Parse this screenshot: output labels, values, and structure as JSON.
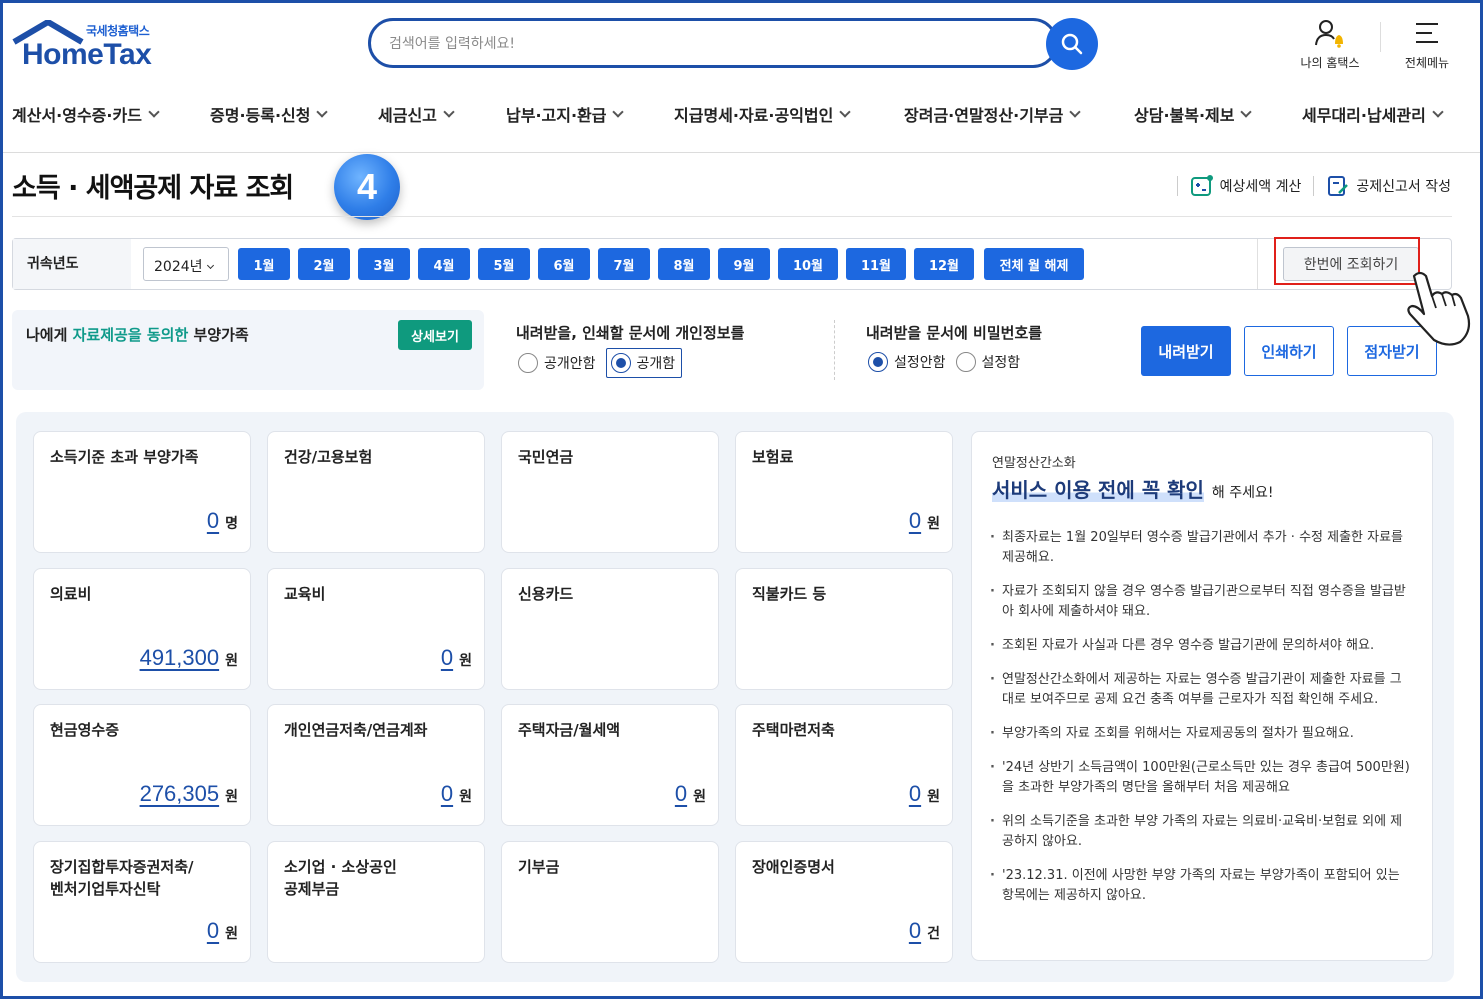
{
  "header": {
    "logo_small": "국세청홈택스",
    "logo_big": "HomeTax",
    "search_placeholder": "검색어를 입력하세요!",
    "my_hometax": "나의 홈택스",
    "all_menu": "전체메뉴"
  },
  "nav": {
    "items": [
      {
        "label": "계산서·영수증·카드"
      },
      {
        "label": "증명·등록·신청"
      },
      {
        "label": "세금신고"
      },
      {
        "label": "납부·고지·환급"
      },
      {
        "label": "지급명세·자료·공익법인"
      },
      {
        "label": "장려금·연말정산·기부금"
      },
      {
        "label": "상담·불복·제보"
      },
      {
        "label": "세무대리·납세관리"
      }
    ]
  },
  "page": {
    "title": "소득 · 세액공제 자료 조회",
    "step_number": "4",
    "action_estimate": "예상세액 계산",
    "action_write": "공제신고서 작성"
  },
  "filter": {
    "label": "귀속년도",
    "year": "2024년",
    "months": [
      "1월",
      "2월",
      "3월",
      "4월",
      "5월",
      "6월",
      "7월",
      "8월",
      "9월",
      "10월",
      "11월",
      "12월"
    ],
    "clear_all": "전체 월 해제",
    "query_all": "한번에 조회하기"
  },
  "consent": {
    "prefix": "나에게 ",
    "highlight": "자료제공을 동의한",
    "suffix": " 부양가족",
    "detail_btn": "상세보기"
  },
  "privacy": {
    "title": "내려받을, 인쇄할 문서에 개인정보를",
    "opt1": "공개안함",
    "opt2": "공개함",
    "selected": "공개함"
  },
  "password": {
    "title": "내려받을 문서에 비밀번호를",
    "opt1": "설정안함",
    "opt2": "설정함",
    "selected": "설정안함"
  },
  "actions": {
    "download": "내려받기",
    "print": "인쇄하기",
    "braille": "점자받기"
  },
  "cards": [
    {
      "title": "소득기준 초과 부양가족",
      "value": "0",
      "unit": "명"
    },
    {
      "title": "건강/고용보험",
      "value": "",
      "unit": ""
    },
    {
      "title": "국민연금",
      "value": "",
      "unit": ""
    },
    {
      "title": "보험료",
      "value": "0",
      "unit": "원"
    },
    {
      "title": "의료비",
      "value": "491,300",
      "unit": "원"
    },
    {
      "title": "교육비",
      "value": "0",
      "unit": "원"
    },
    {
      "title": "신용카드",
      "value": "",
      "unit": ""
    },
    {
      "title": "직불카드 등",
      "value": "",
      "unit": ""
    },
    {
      "title": "현금영수증",
      "value": "276,305",
      "unit": "원"
    },
    {
      "title": "개인연금저축/연금계좌",
      "value": "0",
      "unit": "원"
    },
    {
      "title": "주택자금/월세액",
      "value": "0",
      "unit": "원"
    },
    {
      "title": "주택마련저축",
      "value": "0",
      "unit": "원"
    },
    {
      "title": "장기집합투자증권저축/\n벤처기업투자신탁",
      "value": "0",
      "unit": "원"
    },
    {
      "title": "소기업 · 소상공인\n공제부금",
      "value": "",
      "unit": ""
    },
    {
      "title": "기부금",
      "value": "",
      "unit": ""
    },
    {
      "title": "장애인증명서",
      "value": "0",
      "unit": "건"
    }
  ],
  "notice": {
    "subtitle": "연말정산간소화",
    "title_main": "서비스 이용 전에 꼭 확인",
    "title_tail": "해 주세요!",
    "items": [
      "최종자료는 1월 20일부터 영수증 발급기관에서 추가 · 수정 제출한 자료를 제공해요.",
      "자료가 조회되지 않을 경우 영수증 발급기관으로부터 직접 영수증을 발급받아 회사에 제출하셔야 돼요.",
      "조회된 자료가 사실과 다른 경우 영수증 발급기관에 문의하셔야 해요.",
      "연말정산간소화에서 제공하는 자료는 영수증 발급기관이 제출한 자료를 그대로 보여주므로 공제 요건 충족 여부를 근로자가 직접 확인해 주세요.",
      "부양가족의 자료 조회를 위해서는 자료제공동의 절차가 필요해요.",
      "'24년 상반기 소득금액이 100만원(근로소득만 있는 경우 총급여 500만원)을 초과한 부양가족의 명단을 올해부터 처음 제공해요",
      "위의 소득기준을 초과한 부양 가족의 자료는 의료비·교육비·보험료 외에 제공하지 않아요.",
      "'23.12.31. 이전에 사망한 부양 가족의 자료는 부양가족이 포함되어 있는 항목에는 제공하지 않아요."
    ]
  },
  "colors": {
    "primary": "#1d68e0",
    "brand": "#1d4fa8",
    "teal": "#0f9a7e",
    "highlight_red": "#e0201a"
  }
}
